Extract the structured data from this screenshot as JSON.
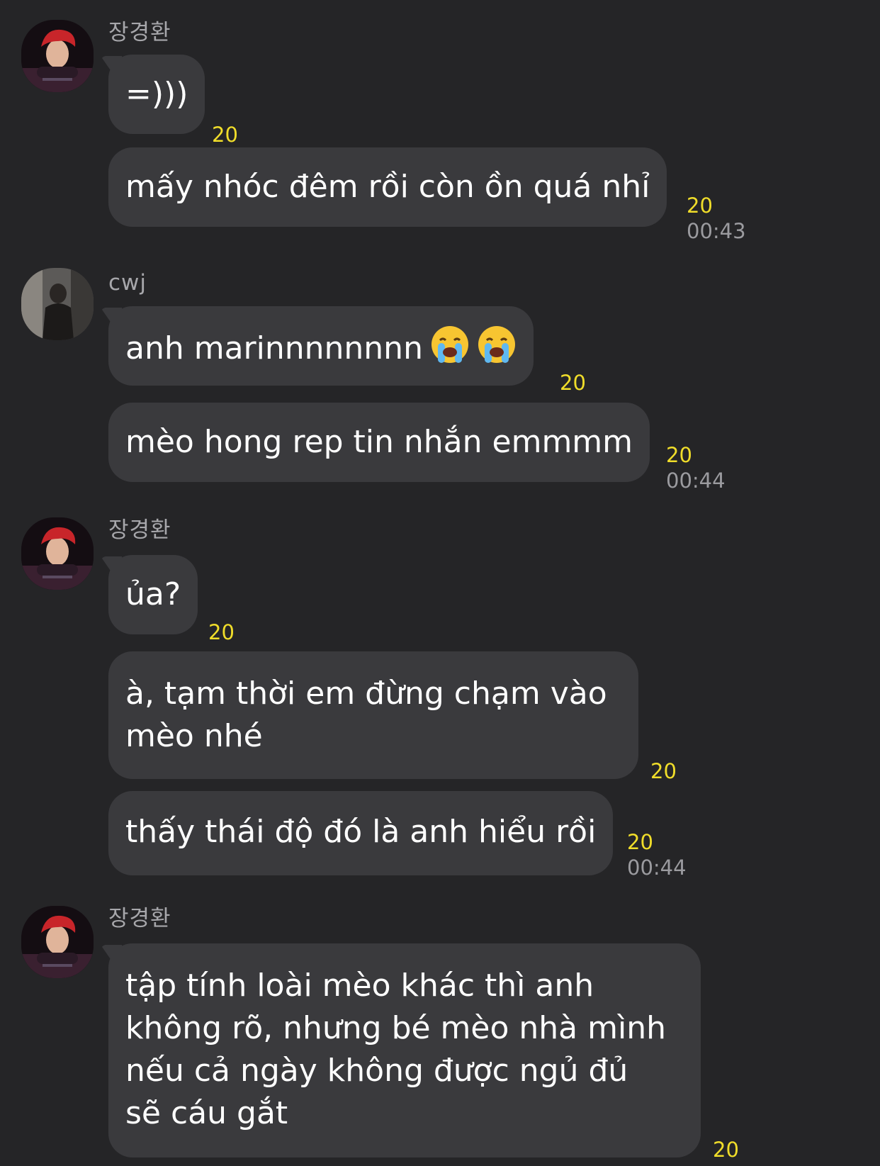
{
  "colors": {
    "background": "#252527",
    "bubble": "#3a3a3d",
    "message_text": "#ffffff",
    "sender_name": "#a7a7ab",
    "unread_count": "#f0dd2a",
    "timestamp": "#9b9b9f"
  },
  "groups": [
    {
      "sender": "장경환",
      "avatar_icon": "red-hair-profile-avatar",
      "messages": [
        {
          "text": "=)))",
          "unread": "20"
        },
        {
          "text": "mấy nhóc đêm rồi còn ồn quá nhỉ",
          "unread": "20",
          "time": "00:43"
        }
      ]
    },
    {
      "sender": "cwj",
      "avatar_icon": "dark-photo-profile-avatar",
      "messages": [
        {
          "text": "anh marinnnnnnnn",
          "emojis": [
            "loudly-crying-face-icon",
            "loudly-crying-face-icon"
          ],
          "unread": "20"
        },
        {
          "text": "mèo hong rep tin nhắn emmmm",
          "unread": "20",
          "time": "00:44"
        }
      ]
    },
    {
      "sender": "장경환",
      "avatar_icon": "red-hair-profile-avatar",
      "messages": [
        {
          "text": "ủa?",
          "unread": "20"
        },
        {
          "text": "à, tạm thời em đừng chạm vào\nmèo nhé",
          "unread": "20"
        },
        {
          "text": "thấy thái độ đó là anh hiểu rồi",
          "unread": "20",
          "time": "00:44"
        }
      ]
    },
    {
      "sender": "장경환",
      "avatar_icon": "red-hair-profile-avatar",
      "messages": [
        {
          "text": "tập tính loài mèo khác thì anh\nkhông rõ, nhưng bé mèo nhà mình\nnếu cả ngày không được ngủ đủ\nsẽ cáu gắt",
          "unread": "20"
        }
      ]
    }
  ]
}
